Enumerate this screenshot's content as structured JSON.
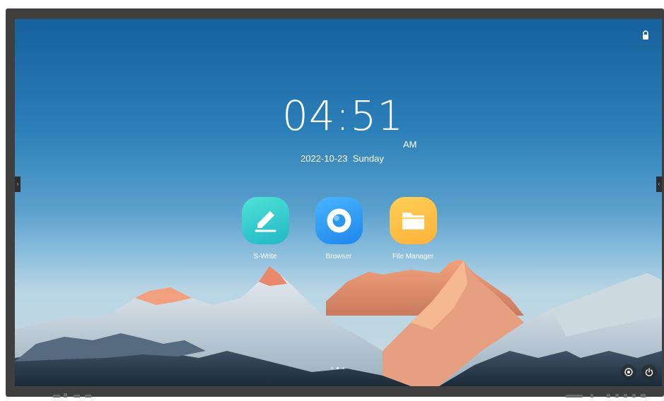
{
  "home": {
    "time": "04:51",
    "ampm": "AM",
    "date": "2022-10-23",
    "weekday": "Sunday",
    "apps": [
      {
        "label": "S-Write",
        "icon": "pen-icon"
      },
      {
        "label": "Browser",
        "icon": "browser-ring-icon"
      },
      {
        "label": "File Manager",
        "icon": "folder-icon"
      }
    ],
    "page_indicator": {
      "count": 3,
      "active": 2
    }
  },
  "icons": {
    "top_right": "lock-icon",
    "left_edge": "chevron-right-icon",
    "right_edge": "chevron-left-icon",
    "bottom_right_1": "settings-icon",
    "bottom_right_2": "power-icon"
  },
  "colors": {
    "sky_top": "#17619d",
    "bezel": "#3f3f40",
    "swrite": "#2cc6ca",
    "browser": "#2b95f0",
    "files": "#ffbf47"
  }
}
